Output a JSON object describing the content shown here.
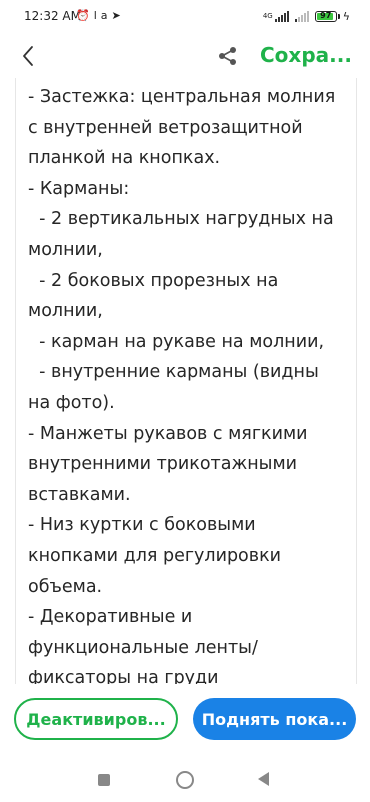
{
  "status_bar": {
    "time": "12:32 AM",
    "icons": [
      "alarm-icon",
      "lamoda-icon",
      "telegram-icon"
    ],
    "network_label": "4G",
    "battery": "97",
    "battery_level": 0.97
  },
  "app_bar": {
    "save_label": "Сохра..."
  },
  "description": {
    "lines": [
      "- Застежка: центральная молния",
      "с внутренней ветрозащитной",
      "планкой на кнопках.",
      "- Карманы:",
      "  - 2 вертикальных нагрудных на",
      "молнии,",
      "  - 2 боковых прорезных на",
      "молнии,",
      "  - карман на рукаве на молнии,",
      "  - внутренние карманы (видны",
      "на фото).",
      "- Манжеты рукавов с мягкими",
      "внутренними трикотажными",
      "вставками.",
      "- Низ куртки с боковыми",
      "кнопками для регулировки",
      "объема.",
      "- Декоративные и",
      "функциональные ленты/",
      "фиксаторы на груди"
    ]
  },
  "actions": {
    "deactivate_label": "Деактивиров...",
    "raise_label": "Поднять пока..."
  },
  "colors": {
    "accent_green": "#1fb24a",
    "accent_blue": "#1a82e6"
  }
}
